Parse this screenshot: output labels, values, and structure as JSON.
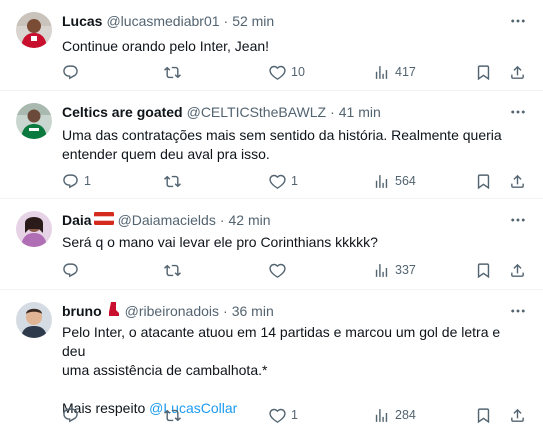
{
  "tweets": [
    {
      "name": "Lucas",
      "handle": "@lucasmediabr01",
      "time": "52 min",
      "text": "Continue orando pelo Inter, Jean!",
      "replies": "",
      "retweets": "",
      "likes": "10",
      "views": "417"
    },
    {
      "name": "Celtics are goated",
      "handle": "@CELTICStheBAWLZ",
      "time": "41 min",
      "text_line1": "Uma das contratações mais sem sentido da história. Realmente queria",
      "text_line2": "entender quem deu aval pra isso.",
      "replies": "1",
      "retweets": "",
      "likes": "1",
      "views": "564"
    },
    {
      "name": "Daia",
      "handle": "@Daiamacields",
      "time": "42 min",
      "text": "Será q o mano vai levar ele pro Corinthians kkkkk?",
      "replies": "",
      "retweets": "",
      "likes": "",
      "views": "337"
    },
    {
      "name": "bruno",
      "handle": "@ribeironadois",
      "time": "36 min",
      "text_line1": "Pelo Inter, o atacante atuou em 14 partidas e marcou um gol de letra e deu",
      "text_line2": "uma assistência de cambalhota.*",
      "text_line3": "Mais respeito",
      "mention": "@LucasCollar",
      "replies": "",
      "retweets": "",
      "likes": "1",
      "views": "284"
    }
  ],
  "separator": "·",
  "colors": {
    "text": "#0f1419",
    "secondary": "#536471",
    "link": "#1d9bf0",
    "divider": "#eff3f4"
  },
  "icons": [
    "more-icon",
    "reply-icon",
    "retweet-icon",
    "like-icon",
    "views-icon",
    "bookmark-icon",
    "share-icon",
    "flag-icon"
  ]
}
